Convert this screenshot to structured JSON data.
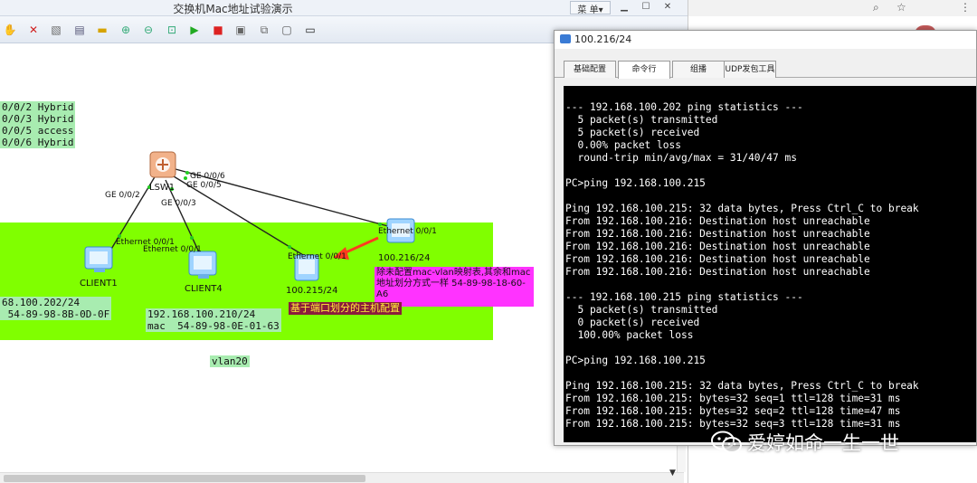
{
  "main_window": {
    "title": "交换机Mac地址试验演示",
    "menu_label": "菜 单▾"
  },
  "topology": {
    "port_config": "0/0/2 Hybrid\n0/0/3 Hybrid\n0/0/5 access\n0/0/6 Hybrid",
    "switch_name": "LSW1",
    "ports": {
      "ge002": "GE 0/0/2",
      "ge003": "GE 0/0/3",
      "ge005": "GE 0/0/5",
      "ge006": "GE 0/0/6",
      "eth_client1": "Ethernet 0/0/1",
      "eth_client4": "Ethernet 0/0/1",
      "eth_pc215": "Ethernet 0/0/1",
      "eth_pc216": "Ethernet 0/0/1"
    },
    "devices": {
      "client1": "CLIENT1",
      "client4": "CLIENT4",
      "pc215": "100.215/24",
      "pc216": "100.216/24"
    },
    "client1_info": "68.100.202/24\n 54-89-98-8B-0D-0F",
    "client4_info": "192.168.100.210/24\nmac  54-89-98-0E-01-63",
    "mac_note": "除未配置mac-vlan映射表,其余和mac地址划分方式一样 54-89-98-18-60-A6",
    "port_note": "基于端口划分的主机配置",
    "vlan_label": "vlan20"
  },
  "console": {
    "title": "100.216/24",
    "tabs": [
      "基础配置",
      "命令行",
      "组播",
      "UDP发包工具"
    ],
    "active_tab": 1,
    "lines": [
      "",
      "--- 192.168.100.202 ping statistics ---",
      "  5 packet(s) transmitted",
      "  5 packet(s) received",
      "  0.00% packet loss",
      "  round-trip min/avg/max = 31/40/47 ms",
      "",
      "PC>ping 192.168.100.215",
      "",
      "Ping 192.168.100.215: 32 data bytes, Press Ctrl_C to break",
      "From 192.168.100.216: Destination host unreachable",
      "From 192.168.100.216: Destination host unreachable",
      "From 192.168.100.216: Destination host unreachable",
      "From 192.168.100.216: Destination host unreachable",
      "From 192.168.100.216: Destination host unreachable",
      "",
      "--- 192.168.100.215 ping statistics ---",
      "  5 packet(s) transmitted",
      "  0 packet(s) received",
      "  100.00% packet loss",
      "",
      "PC>ping 192.168.100.215",
      "",
      "Ping 192.168.100.215: 32 data bytes, Press Ctrl_C to break",
      "From 192.168.100.215: bytes=32 seq=1 ttl=128 time=31 ms",
      "From 192.168.100.215: bytes=32 seq=2 ttl=128 time=47 ms",
      "From 192.168.100.215: bytes=32 seq=3 ttl=128 time=31 ms"
    ]
  },
  "watermark": {
    "text": "爱婷如命一生一世",
    "icon": "wechat-icon"
  },
  "colors": {
    "vlan_zone": "#80ff00",
    "note_bg": "#a8ecb0",
    "mac_note_bg": "#ff33ff",
    "port_note_bg": "#8b1c3c",
    "arrow": "#ff3b1f",
    "terminal_bg": "#000000"
  }
}
